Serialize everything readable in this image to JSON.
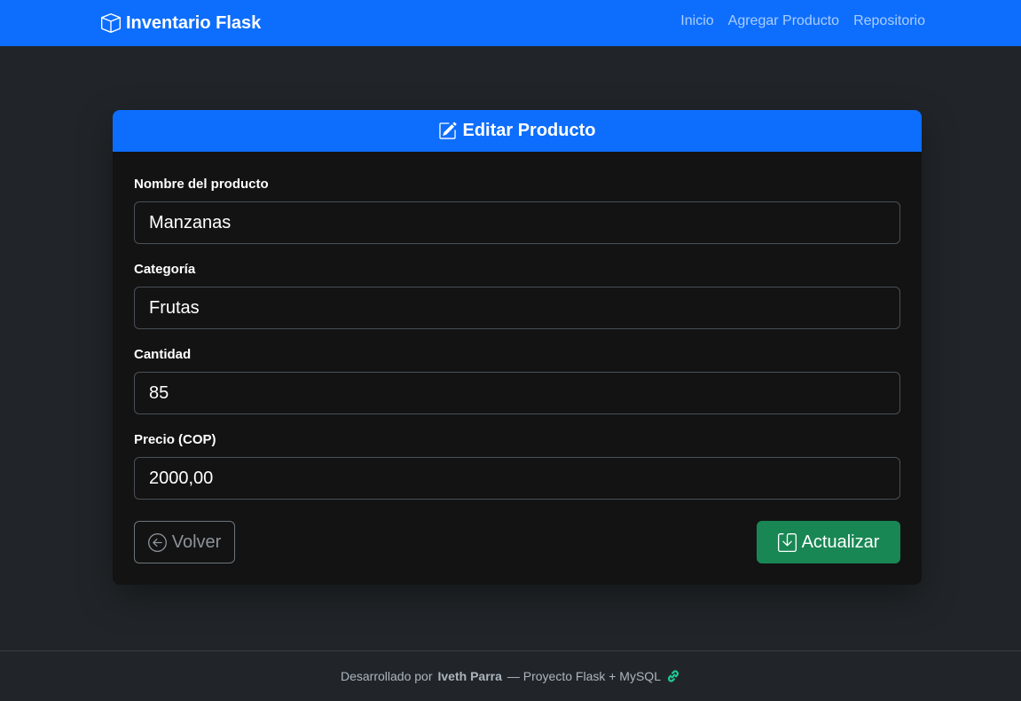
{
  "navbar": {
    "brand": "Inventario Flask",
    "brand_icon": "box-icon",
    "links": [
      "Inicio",
      "Agregar Producto",
      "Repositorio"
    ]
  },
  "card": {
    "title": "Editar Producto",
    "title_icon": "pencil-square-icon",
    "fields": [
      {
        "label": "Nombre del producto",
        "value": "Manzanas"
      },
      {
        "label": "Categoría",
        "value": "Frutas"
      },
      {
        "label": "Cantidad",
        "value": "85"
      },
      {
        "label": "Precio (COP)",
        "value": "2000,00"
      }
    ],
    "back_label": "Volver",
    "back_icon": "arrow-left-circle-icon",
    "update_label": "Actualizar",
    "update_icon": "save-down-arrow-icon"
  },
  "footer": {
    "prefix": "Desarrollado por",
    "author": "Iveth Parra",
    "suffix": "— Proyecto Flask + MySQL",
    "icon": "link-icon"
  },
  "colors": {
    "primary": "#0d6efd",
    "success": "#198754",
    "background": "#212529",
    "card": "#131313"
  }
}
